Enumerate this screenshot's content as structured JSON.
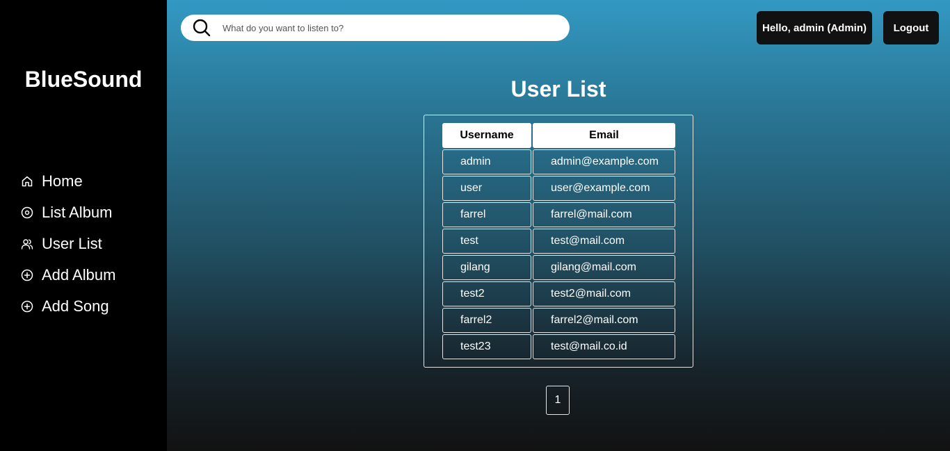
{
  "brand": "BlueSound",
  "nav": [
    {
      "label": "Home",
      "icon": "home-icon"
    },
    {
      "label": "List Album",
      "icon": "disc-icon"
    },
    {
      "label": "User List",
      "icon": "users-icon"
    },
    {
      "label": "Add Album",
      "icon": "plus-circle-icon"
    },
    {
      "label": "Add Song",
      "icon": "plus-circle-icon"
    }
  ],
  "search": {
    "placeholder": "What do you want to listen to?",
    "icon": "search-icon"
  },
  "header": {
    "greeting": "Hello, admin (Admin)",
    "logout": "Logout"
  },
  "page_title": "User List",
  "table": {
    "columns": [
      "Username",
      "Email"
    ],
    "rows": [
      [
        "admin",
        "admin@example.com"
      ],
      [
        "user",
        "user@example.com"
      ],
      [
        "farrel",
        "farrel@mail.com"
      ],
      [
        "test",
        "test@mail.com"
      ],
      [
        "gilang",
        "gilang@mail.com"
      ],
      [
        "test2",
        "test2@mail.com"
      ],
      [
        "farrel2",
        "farrel2@mail.com"
      ],
      [
        "test23",
        "test@mail.co.id"
      ]
    ]
  },
  "pagination": {
    "pages": [
      "1"
    ]
  },
  "colors": {
    "sidebar": "#000000",
    "gradient_top": "#3399c2",
    "gradient_bottom": "#121212",
    "button_dark": "#111111"
  }
}
